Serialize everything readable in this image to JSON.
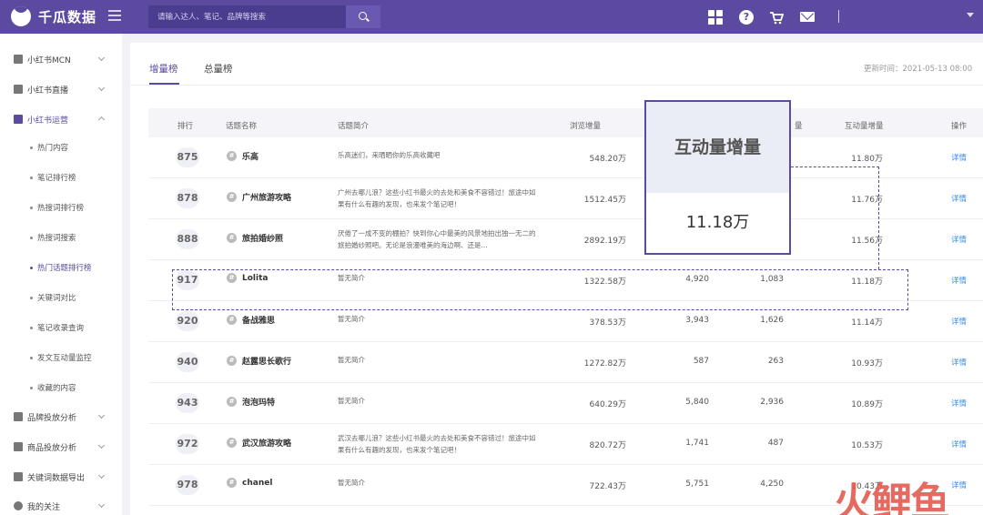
{
  "app": {
    "name": "千瓜数据",
    "search_placeholder": "请输入达人、笔记、品牌等搜索",
    "help_label": "?"
  },
  "sidebar": {
    "groups": [
      {
        "label": "小红书MCN",
        "icon": "building-icon"
      },
      {
        "label": "小红书直播",
        "icon": "video-icon"
      },
      {
        "label": "小红书运营",
        "icon": "operation-icon"
      },
      {
        "label": "品牌投放分析",
        "icon": "chart-icon"
      },
      {
        "label": "商品投放分析",
        "icon": "shop-icon"
      },
      {
        "label": "关键词数据导出",
        "icon": "export-icon"
      },
      {
        "label": "我的关注",
        "icon": "eye-icon"
      }
    ],
    "sub_items": [
      "热门内容",
      "笔记排行榜",
      "热搜词排行榜",
      "热搜词搜索",
      "热门话题排行榜",
      "关键词对比",
      "笔记收录查询",
      "发文互动量监控",
      "收藏的内容"
    ]
  },
  "tabs": {
    "increment": "增量榜",
    "total": "总量榜"
  },
  "update_time": "更新时间：2021-05-13 08:00",
  "table": {
    "headers": {
      "rank": "排行",
      "topic": "话题名称",
      "intro": "话题简介",
      "views": "浏览增量",
      "comments_partial": "量",
      "interaction": "互动量增量",
      "action": "操作"
    },
    "detail_label": "详情",
    "rows": [
      {
        "rank": "875",
        "topic": "乐高",
        "intro": "乐高迷们，来晒晒你的乐高收藏吧",
        "views": "548.20万",
        "likes": "",
        "comments": "",
        "interaction": "11.80万"
      },
      {
        "rank": "878",
        "topic": "广州旅游攻略",
        "intro": "广州去哪儿浪？这些小红书最火的去处和美食不容错过！旅途中如果有什么有趣的发现，也来发个笔记吧！",
        "views": "1512.45万",
        "likes": "",
        "comments": "",
        "interaction": "11.76万"
      },
      {
        "rank": "888",
        "topic": "旅拍婚纱照",
        "intro": "厌倦了一成不变的棚拍？快到你心中最美的风景地拍出独一无二的旅拍婚纱照吧。无论是浪漫唯美的海边啊、还是...",
        "views": "2892.19万",
        "likes": "",
        "comments": "",
        "interaction": "11.56万"
      },
      {
        "rank": "917",
        "topic": "Lolita",
        "intro": "暂无简介",
        "views": "1322.58万",
        "likes": "4,920",
        "comments": "1,083",
        "interaction": "11.18万"
      },
      {
        "rank": "920",
        "topic": "备战雅思",
        "intro": "暂无简介",
        "views": "378.53万",
        "likes": "3,943",
        "comments": "1,626",
        "interaction": "11.14万"
      },
      {
        "rank": "940",
        "topic": "赵露思长歌行",
        "intro": "暂无简介",
        "views": "1272.82万",
        "likes": "587",
        "comments": "263",
        "interaction": "10.93万"
      },
      {
        "rank": "943",
        "topic": "泡泡玛特",
        "intro": "暂无简介",
        "views": "640.29万",
        "likes": "5,840",
        "comments": "2,936",
        "interaction": "10.89万"
      },
      {
        "rank": "972",
        "topic": "武汉旅游攻略",
        "intro": "武汉去哪儿浪？这些小红书最火的去处和美食不容错过！旅途中如果有什么有趣的发现，也来发个笔记吧！",
        "views": "820.72万",
        "likes": "1,741",
        "comments": "487",
        "interaction": "10.53万"
      },
      {
        "rank": "978",
        "topic": "chanel",
        "intro": "暂无简介",
        "views": "722.43万",
        "likes": "5,751",
        "comments": "4,250",
        "interaction": "10.43万"
      }
    ]
  },
  "highlight": {
    "title": "互动量增量",
    "value": "11.18万"
  },
  "watermark": "火鲤鱼",
  "colors": {
    "brand": "#5b4aa0",
    "link": "#3a8ee6",
    "watermark": "#e45a4f"
  }
}
